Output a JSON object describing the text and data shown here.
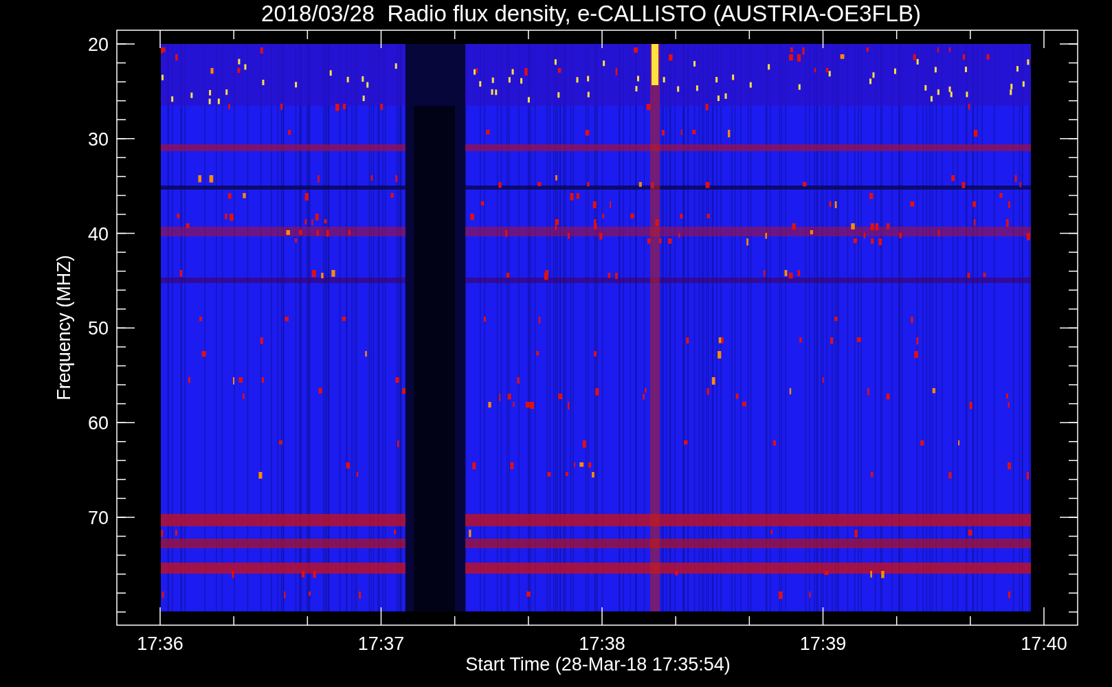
{
  "title": "2018/03/28  Radio flux density, e-CALLISTO (AUSTRIA-OE3FLB)",
  "y_axis": {
    "label": "Frequency (MHZ)",
    "ticks": [
      "20",
      "30",
      "40",
      "50",
      "60",
      "70"
    ]
  },
  "x_axis": {
    "label": "Start Time (28-Mar-18 17:35:54)",
    "ticks": [
      "17:36",
      "17:37",
      "17:38",
      "17:39",
      "17:40"
    ]
  }
}
